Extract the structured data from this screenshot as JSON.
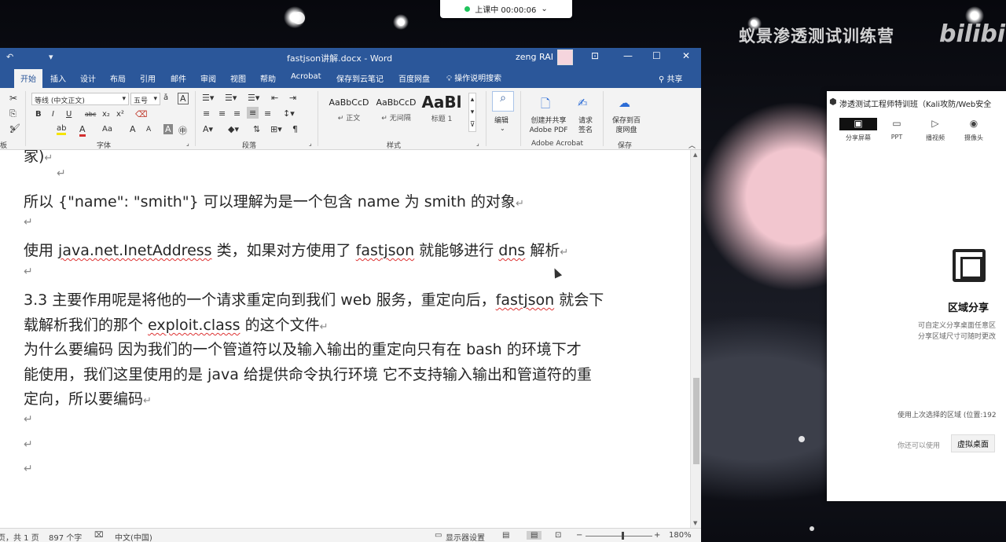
{
  "watermark": "蚁景渗透测试训练营",
  "watermark_logo": "bilibili",
  "class_timer": {
    "label": "上课中 00:00:06",
    "dropdown": "⌄"
  },
  "word": {
    "title": "fastjson讲解.docx - Word",
    "user": "zeng RAI",
    "undo_icon": "↶",
    "quick_access": "▾",
    "window_controls": {
      "ribbon_display": "⊡",
      "minimize": "—",
      "maximize": "☐",
      "close": "✕"
    },
    "tabs": [
      "开始",
      "插入",
      "设计",
      "布局",
      "引用",
      "邮件",
      "审阅",
      "视图",
      "帮助",
      "Acrobat",
      "保存到云笔记",
      "百度网盘"
    ],
    "tell_me": "操作说明搜索",
    "share": "共享",
    "ribbon": {
      "font_name": "等线 (中文正文)",
      "font_size": "五号",
      "font_group": "字体",
      "paragraph_group": "段落",
      "styles_group": "样式",
      "styles": [
        {
          "preview": "AaBbCcD",
          "name": "正文"
        },
        {
          "preview": "AaBbCcD",
          "name": "无间隔"
        },
        {
          "preview": "AaBl",
          "name": "标题 1"
        }
      ],
      "edit_label": "编辑",
      "acrobat_create": "创建并共享 Adobe PDF",
      "acrobat_sign": "请求签名",
      "acrobat_group": "Adobe Acrobat",
      "save_baidu": "保存到百度网盘",
      "save_group": "保存",
      "clipboard_group": "板",
      "format_buttons": {
        "bold": "B",
        "italic": "I",
        "underline": "U",
        "strike": "abc",
        "subscript": "x₂",
        "superscript": "x²",
        "font_color": "A",
        "highlight": "ab",
        "grow": "A",
        "shrink": "A",
        "change_case": "Aa",
        "char_border": "A",
        "enclose": "㊥"
      }
    },
    "document": {
      "lines": [
        {
          "text": "家)"
        },
        {
          "text": "所以 {\"name\": \"smith\"} 可以理解为是一个包含 name 为 smith 的对象"
        },
        {
          "text": "使用 java.net.InetAddress 类，如果对方使用了 fastjson 就能够进行 dns 解析"
        },
        {
          "text": "3.3 主要作用呢是将他的一个请求重定向到我们 web 服务，重定向后，fastjson 就会下"
        },
        {
          "text": "载解析我们的那个 exploit.class 的这个文件"
        },
        {
          "text": "为什么要编码 因为我们的一个管道符以及输入输出的重定向只有在 bash 的环境下才"
        },
        {
          "text": "能使用，我们这里使用的是 java 给提供命令执行环境 它不支持输入输出和管道符的重"
        },
        {
          "text": "定向，所以要编码"
        }
      ],
      "para_mark": "↵"
    },
    "status": {
      "page": "页，共 1 页",
      "words": "897 个字",
      "language": "中文(中国)",
      "display_settings": "显示器设置",
      "zoom": "180%",
      "zoom_minus": "−",
      "zoom_plus": "+"
    }
  },
  "share_panel": {
    "title": "渗透测试工程师特训班（Kali攻防/Web安全",
    "tabs": [
      {
        "label": "分享屏幕",
        "icon": "screen-icon"
      },
      {
        "label": "PPT",
        "icon": "ppt-icon"
      },
      {
        "label": "播视频",
        "icon": "video-icon"
      },
      {
        "label": "摄像头",
        "icon": "camera-icon"
      }
    ],
    "region_title": "区域分享",
    "region_desc_1": "可自定义分享桌面任意区",
    "region_desc_2": "分享区域尺寸可随时更改",
    "last_region": "使用上次选择的区域 (位置:192",
    "also_text": "你还可以使用",
    "virtual_desktop": "虚拟桌面"
  }
}
